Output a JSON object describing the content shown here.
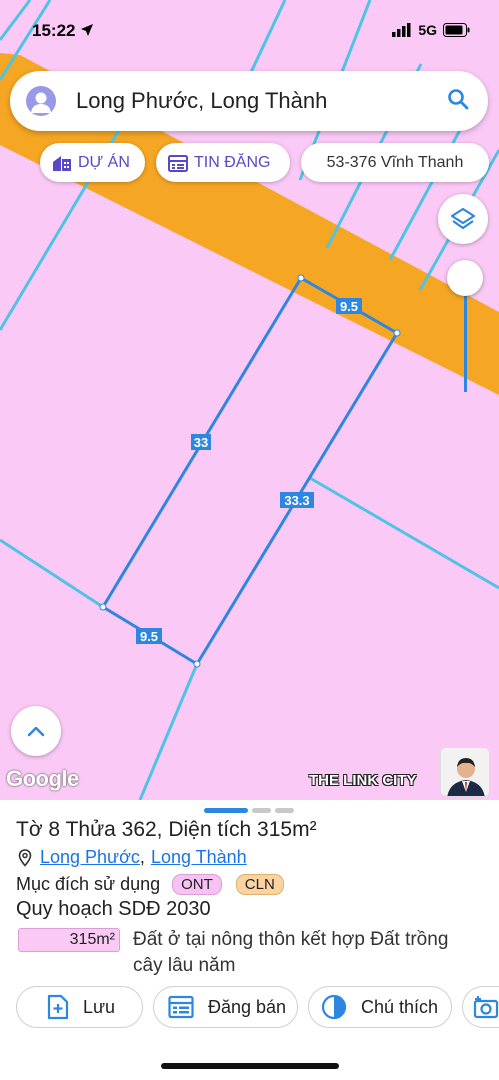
{
  "status": {
    "time": "15:22",
    "network": "5G"
  },
  "search": {
    "text": "Long Phước, Long Thành"
  },
  "chips": [
    {
      "label": "DỰ ÁN"
    },
    {
      "label": "TIN ĐĂNG"
    },
    {
      "label": "53-376 Vĩnh Thanh"
    }
  ],
  "map": {
    "edge_labels": {
      "top": "9.5",
      "left": "33",
      "right": "33.3",
      "bottom": "9.5"
    },
    "attribution": "Google",
    "watermark": "THE LINK CITY",
    "colors": {
      "land": "#fbc9f6",
      "road": "#f5a623",
      "boundary": "#2d86e0",
      "lines": "#4fc3e6"
    }
  },
  "parcel": {
    "title": "Tờ 8 Thửa 362, Diện tích 315m²",
    "ward": "Long Phước",
    "district": "Long Thành",
    "purpose_label": "Mục đích sử dụng",
    "tags": [
      {
        "code": "ONT",
        "color": "#f7c2f3"
      },
      {
        "code": "CLN",
        "color": "#fbd3a0"
      }
    ],
    "plan_title": "Quy hoạch SDĐ 2030",
    "plan_area": "315m²",
    "plan_desc": "Đất ở tại nông thôn kết hợp Đất trồng cây lâu năm"
  },
  "actions": [
    {
      "label": "Lưu"
    },
    {
      "label": "Đăng bán"
    },
    {
      "label": "Chú thích"
    }
  ]
}
